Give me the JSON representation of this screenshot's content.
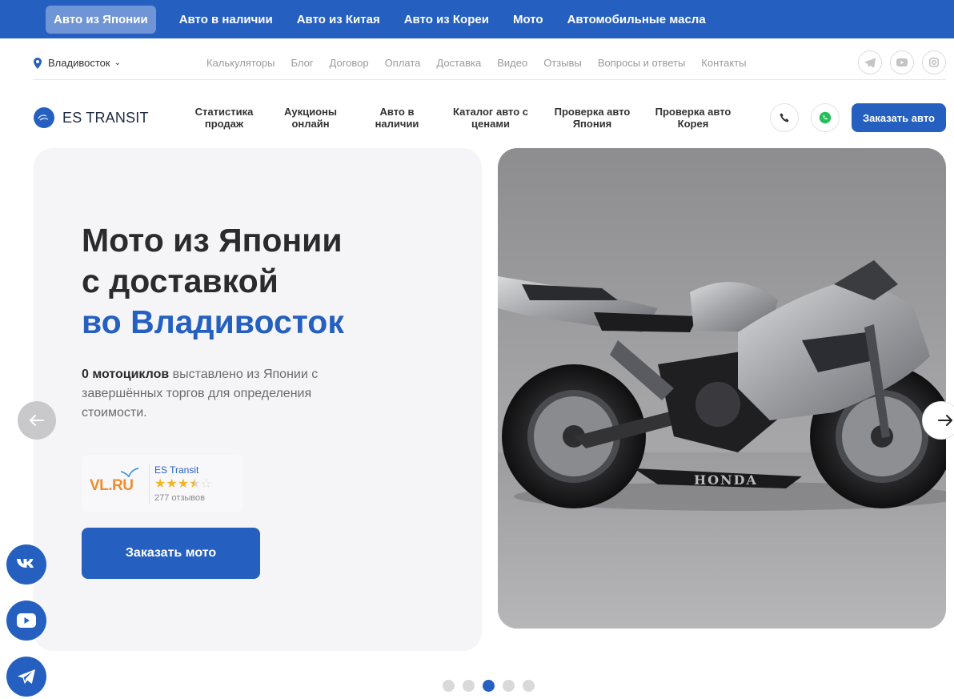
{
  "topnav": {
    "items": [
      {
        "label": "Авто из Японии",
        "active": true
      },
      {
        "label": "Авто в наличии"
      },
      {
        "label": "Авто из Китая"
      },
      {
        "label": "Авто из Кореи"
      },
      {
        "label": "Мото"
      },
      {
        "label": "Автомобильные масла"
      }
    ]
  },
  "utilbar": {
    "city": "Владивосток",
    "links": [
      "Калькуляторы",
      "Блог",
      "Договор",
      "Оплата",
      "Доставка",
      "Видео",
      "Отзывы",
      "Вопросы и ответы",
      "Контакты"
    ],
    "social_icons": [
      "telegram-icon",
      "youtube-icon",
      "instagram-icon"
    ]
  },
  "header": {
    "logo": "ES TRANSIT",
    "menu": [
      {
        "line1": "Статистика",
        "line2": "продаж"
      },
      {
        "line1": "Аукционы",
        "line2": "онлайн"
      },
      {
        "line1": "Авто в",
        "line2": "наличии"
      },
      {
        "line1": "Каталог авто с",
        "line2": "ценами"
      },
      {
        "line1": "Проверка авто",
        "line2": "Япония"
      },
      {
        "line1": "Проверка авто",
        "line2": "Корея"
      }
    ],
    "order_label": "Заказать авто"
  },
  "hero": {
    "title_line1": "Мото из Японии",
    "title_line2": "с доставкой",
    "title_line3": "во Владивосток",
    "desc_bold": "0 мотоциклов",
    "desc_rest": " выставлено из Японии с завершённых торгов для определения стоимости.",
    "rating": {
      "source": "VL.RU",
      "name": "ES Transit",
      "stars": 3.5,
      "count_text": "277 отзывов"
    },
    "cta": "Заказать мото",
    "image_brand": "HONDA"
  },
  "slider": {
    "total": 5,
    "active": 3
  },
  "colors": {
    "brand": "#2560c0",
    "star": "#f2b624",
    "vl_orange": "#f08c2a"
  }
}
